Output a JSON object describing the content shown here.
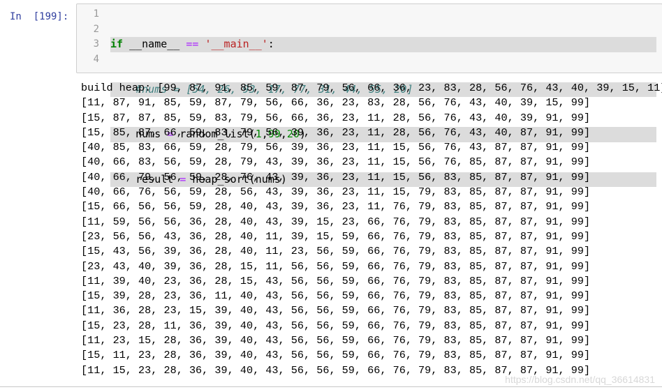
{
  "cell": {
    "prompt": "In  [199]:",
    "line_numbers": [
      "1",
      "2",
      "3",
      "4"
    ],
    "code": {
      "line1": {
        "kw": "if",
        "a": " __name__ ",
        "op": "==",
        "sp": " ",
        "str": "'__main__'",
        "end": ":"
      },
      "line2": {
        "comment": "#nums = [54, 26, 93, 17, 77, 31, 44, 55, 20]"
      },
      "line3": {
        "a": "nums ",
        "op": "=",
        "b": " random_list(",
        "n1": "1",
        "c1": ",",
        "n2": "99",
        "c2": ",",
        "n3": "20",
        "end": ")"
      },
      "line4": {
        "a": "result ",
        "op": "=",
        "b": " heap_sort(nums)"
      }
    }
  },
  "output": {
    "lines": [
      "build heap: [99, 87, 91, 85, 59, 87, 79, 56, 66, 36, 23, 83, 28, 56, 76, 43, 40, 39, 15, 11]",
      "[11, 87, 91, 85, 59, 87, 79, 56, 66, 36, 23, 83, 28, 56, 76, 43, 40, 39, 15, 99]",
      "[15, 87, 87, 85, 59, 83, 79, 56, 66, 36, 23, 11, 28, 56, 76, 43, 40, 39, 91, 99]",
      "[15, 85, 87, 66, 59, 83, 79, 56, 39, 36, 23, 11, 28, 56, 76, 43, 40, 87, 91, 99]",
      "[40, 85, 83, 66, 59, 28, 79, 56, 39, 36, 23, 11, 15, 56, 76, 43, 87, 87, 91, 99]",
      "[40, 66, 83, 56, 59, 28, 79, 43, 39, 36, 23, 11, 15, 56, 76, 85, 87, 87, 91, 99]",
      "[40, 66, 79, 56, 59, 28, 76, 43, 39, 36, 23, 11, 15, 56, 83, 85, 87, 87, 91, 99]",
      "[40, 66, 76, 56, 59, 28, 56, 43, 39, 36, 23, 11, 15, 79, 83, 85, 87, 87, 91, 99]",
      "[15, 66, 56, 56, 59, 28, 40, 43, 39, 36, 23, 11, 76, 79, 83, 85, 87, 87, 91, 99]",
      "[11, 59, 56, 56, 36, 28, 40, 43, 39, 15, 23, 66, 76, 79, 83, 85, 87, 87, 91, 99]",
      "[23, 56, 56, 43, 36, 28, 40, 11, 39, 15, 59, 66, 76, 79, 83, 85, 87, 87, 91, 99]",
      "[15, 43, 56, 39, 36, 28, 40, 11, 23, 56, 59, 66, 76, 79, 83, 85, 87, 87, 91, 99]",
      "[23, 43, 40, 39, 36, 28, 15, 11, 56, 56, 59, 66, 76, 79, 83, 85, 87, 87, 91, 99]",
      "[11, 39, 40, 23, 36, 28, 15, 43, 56, 56, 59, 66, 76, 79, 83, 85, 87, 87, 91, 99]",
      "[15, 39, 28, 23, 36, 11, 40, 43, 56, 56, 59, 66, 76, 79, 83, 85, 87, 87, 91, 99]",
      "[11, 36, 28, 23, 15, 39, 40, 43, 56, 56, 59, 66, 76, 79, 83, 85, 87, 87, 91, 99]",
      "[15, 23, 28, 11, 36, 39, 40, 43, 56, 56, 59, 66, 76, 79, 83, 85, 87, 87, 91, 99]",
      "[11, 23, 15, 28, 36, 39, 40, 43, 56, 56, 59, 66, 76, 79, 83, 85, 87, 87, 91, 99]",
      "[15, 11, 23, 28, 36, 39, 40, 43, 56, 56, 59, 66, 76, 79, 83, 85, 87, 87, 91, 99]",
      "[11, 15, 23, 28, 36, 39, 40, 43, 56, 56, 59, 66, 76, 79, 83, 85, 87, 87, 91, 99]"
    ]
  },
  "watermark": "https://blog.csdn.net/qq_36614831"
}
